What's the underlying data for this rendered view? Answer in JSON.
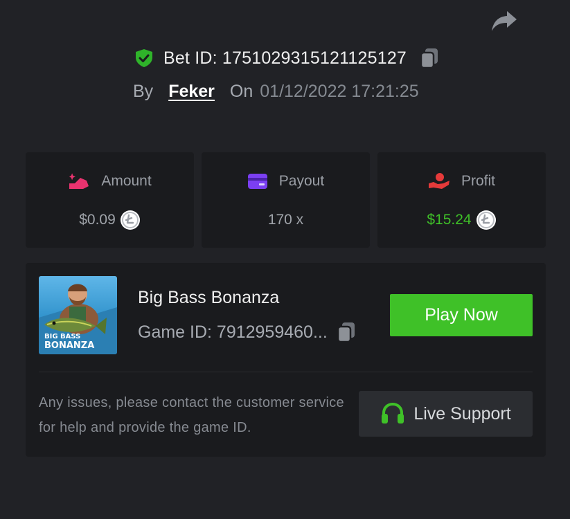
{
  "header": {
    "bet_id_label": "Bet ID: 1751029315121125127",
    "by_label": "By",
    "username": "Feker",
    "on_label": "On",
    "date": "01/12/2022 17:21:25",
    "icons": [
      "share-icon",
      "shield-check-icon",
      "copy-icon"
    ]
  },
  "stats": [
    {
      "label": "Amount",
      "value": "$0.09",
      "icon": "amount-icon",
      "coin": "litecoin-icon",
      "color": "#e8336f"
    },
    {
      "label": "Payout",
      "value": "170 x",
      "icon": "card-icon",
      "color": "#7b3ff2"
    },
    {
      "label": "Profit",
      "value": "$15.24",
      "icon": "hand-user-icon",
      "coin": "litecoin-icon",
      "color": "#e53a3a"
    }
  ],
  "game": {
    "name": "Big Bass Bonanza",
    "id_label": "Game ID: 7912959460...",
    "thumb_line1": "BIG BASS",
    "thumb_line2": "BONANZA",
    "play_label": "Play Now"
  },
  "support": {
    "message": "Any issues, please contact the customer service for help and provide the game ID.",
    "button_label": "Live Support"
  },
  "colors": {
    "background": "#212226",
    "card": "#1a1b1e",
    "accent_green": "#3fc128",
    "profit": "#3fc128"
  }
}
